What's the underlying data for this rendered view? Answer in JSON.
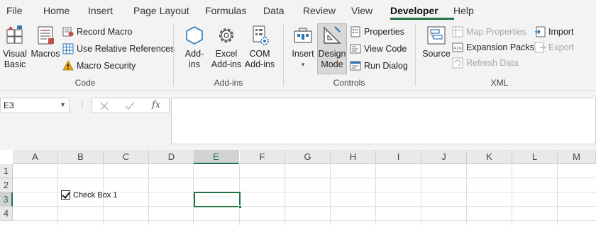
{
  "tabs": [
    "File",
    "Home",
    "Insert",
    "Page Layout",
    "Formulas",
    "Data",
    "Review",
    "View",
    "Developer",
    "Help"
  ],
  "active_tab": "Developer",
  "ribbon": {
    "code": {
      "visual_basic": "Visual Basic",
      "visual_basic_l1": "Visual",
      "visual_basic_l2": "Basic",
      "macros": "Macros",
      "record_macro": "Record Macro",
      "use_relative_references": "Use Relative References",
      "macro_security": "Macro Security",
      "group_label": "Code"
    },
    "addins": {
      "addins_l1": "Add-",
      "addins_l2": "ins",
      "excel_addins_l1": "Excel",
      "excel_addins_l2": "Add-ins",
      "com_addins_l1": "COM",
      "com_addins_l2": "Add-ins",
      "group_label": "Add-ins"
    },
    "controls": {
      "insert": "Insert",
      "design_mode_l1": "Design",
      "design_mode_l2": "Mode",
      "properties": "Properties",
      "view_code": "View Code",
      "run_dialog": "Run Dialog",
      "group_label": "Controls"
    },
    "xml": {
      "source": "Source",
      "map_properties": "Map Properties",
      "expansion_packs": "Expansion Packs",
      "refresh_data": "Refresh Data",
      "import": "Import",
      "export": "Export",
      "group_label": "XML"
    }
  },
  "formula_bar": {
    "name_box": "E3",
    "cancel_icon": "x-icon",
    "enter_icon": "check-icon",
    "fx_label": "fx",
    "formula_value": ""
  },
  "grid": {
    "columns": [
      "A",
      "B",
      "C",
      "D",
      "E",
      "F",
      "G",
      "H",
      "I",
      "J",
      "K",
      "L",
      "M"
    ],
    "selected_column": "E",
    "rows": [
      "1",
      "2",
      "3",
      "4"
    ],
    "selected_row": "3",
    "checkbox_label": "Check Box 1",
    "checkbox_checked": true
  },
  "colors": {
    "accent": "#217346",
    "ribbon_bg": "#f3f3f3",
    "warning": "#e8a317"
  }
}
